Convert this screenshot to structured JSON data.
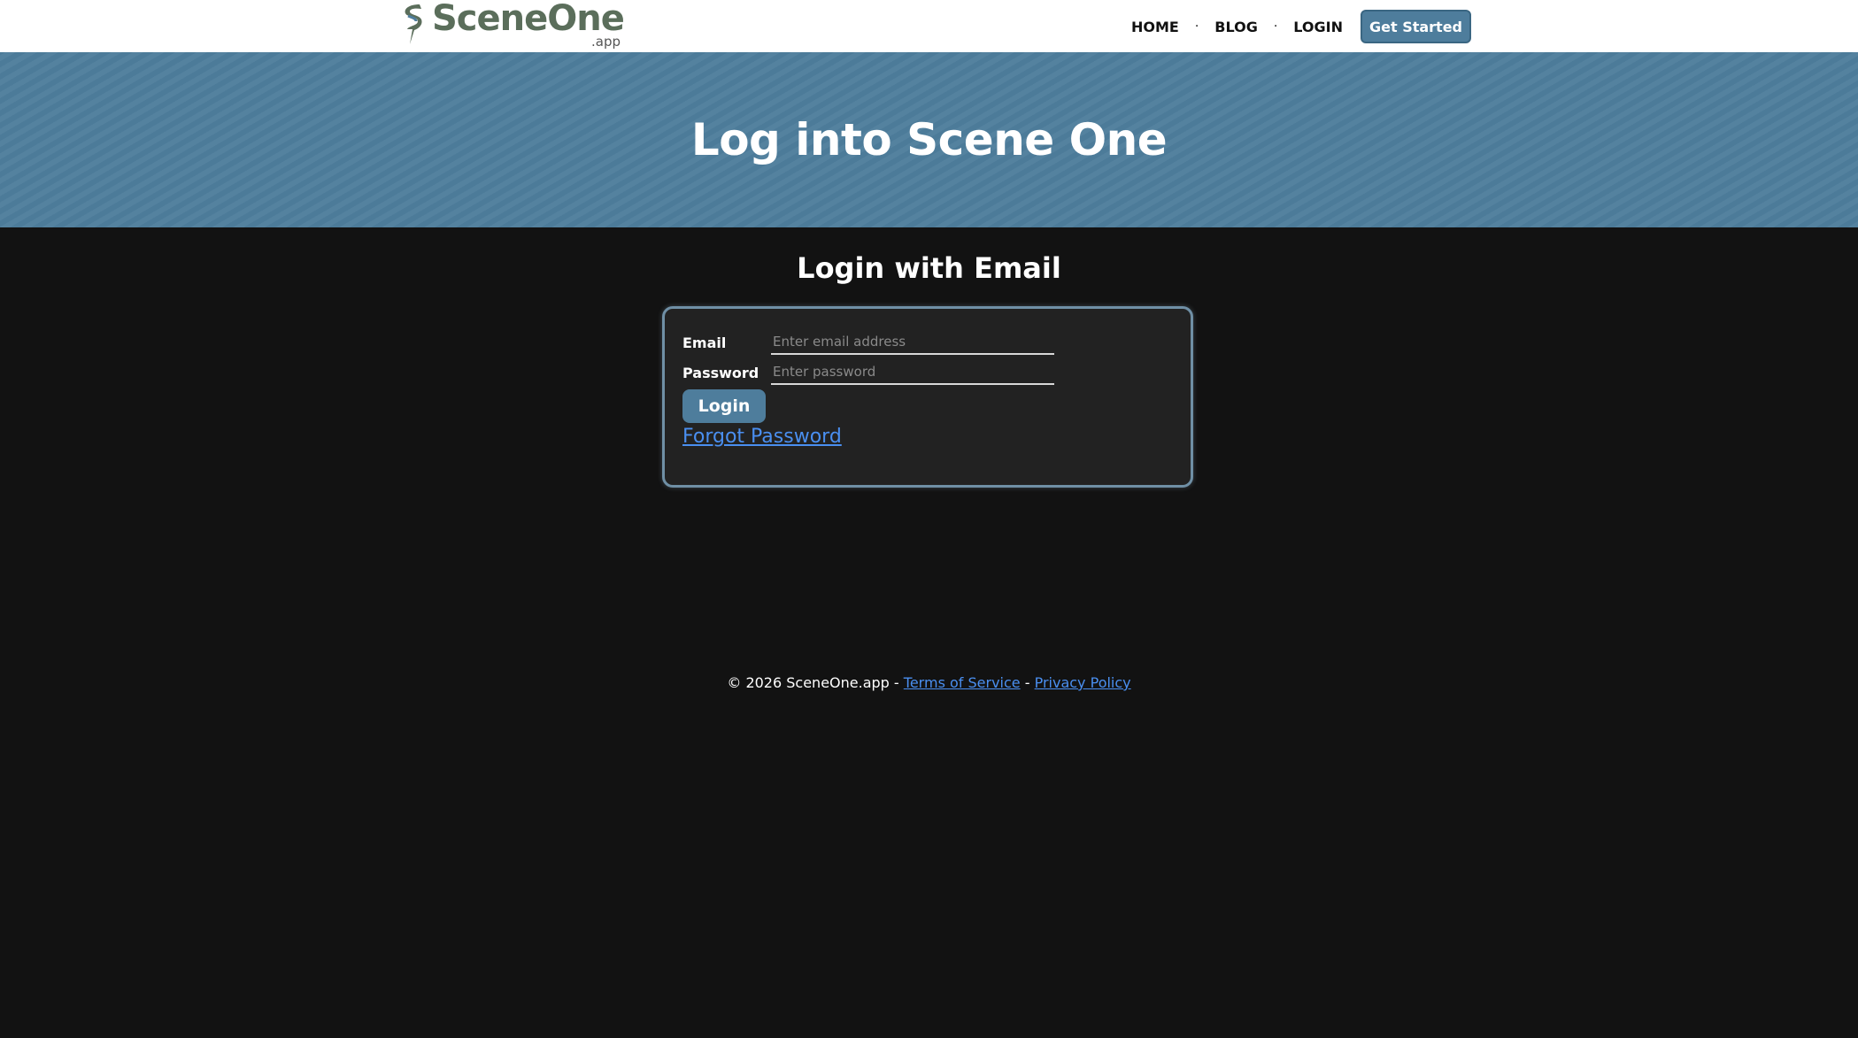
{
  "header": {
    "logo_text": "SceneOne",
    "logo_sub": ".app",
    "nav": [
      {
        "label": "HOME"
      },
      {
        "label": "BLOG"
      },
      {
        "label": "LOGIN"
      }
    ],
    "nav_separator": "·",
    "cta_label": "Get Started"
  },
  "hero": {
    "title": "Log into Scene One"
  },
  "login": {
    "section_title": "Login with Email",
    "email_label": "Email",
    "email_placeholder": "Enter email address",
    "email_value": "",
    "password_label": "Password",
    "password_placeholder": "Enter password",
    "password_value": "",
    "submit_label": "Login",
    "forgot_label": "Forgot Password"
  },
  "footer": {
    "copyright": "© 2026 SceneOne.app",
    "separator": "-",
    "terms_label": "Terms of Service",
    "privacy_label": "Privacy Policy"
  },
  "colors": {
    "brand_blue": "#4e7d9c",
    "logo_green": "#5b6e5b",
    "link_blue": "#4a8ff0",
    "page_bg": "#121212",
    "card_bg": "#222222"
  }
}
